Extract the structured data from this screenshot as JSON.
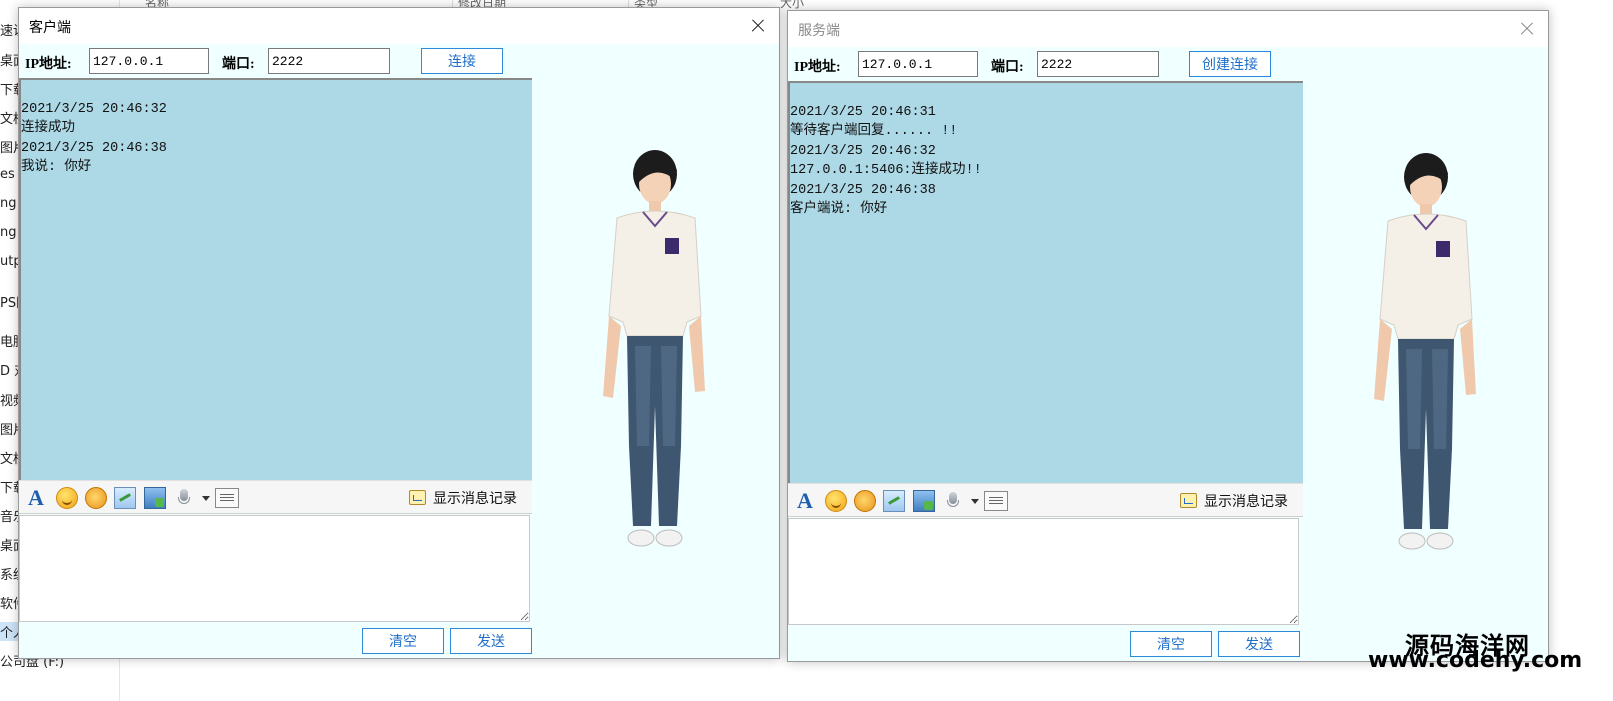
{
  "explorer": {
    "header": {
      "col_name": "名称",
      "col_modified": "修改日期",
      "col_type": "类型",
      "col_size": "大小"
    },
    "nav_items": [
      "速访",
      "桌面",
      "下载",
      "文档",
      "图片",
      "es",
      "ng",
      "ng",
      "utp",
      "PS网",
      "电脑",
      "D 对",
      "视频",
      "图片",
      "文档",
      "下载",
      "音乐",
      "桌面",
      "系统",
      "软件",
      "个人",
      "公司盘 (F:)"
    ]
  },
  "client": {
    "title": "客户端",
    "ip_label": "IP地址:",
    "ip_value": "127.0.0.1",
    "port_label": "端口:",
    "port_value": "2222",
    "connect_label": "连接",
    "log": [
      "",
      "2021/3/25 20:46:32",
      "连接成功",
      "2021/3/25 20:46:38",
      "我说: 你好"
    ],
    "history_label": "显示消息记录",
    "input_value": "",
    "clear_label": "清空",
    "send_label": "发送"
  },
  "server": {
    "title": "服务端",
    "ip_label": "IP地址:",
    "ip_value": "127.0.0.1",
    "port_label": "端口:",
    "port_value": "2222",
    "connect_label": "创建连接",
    "log": [
      "",
      "2021/3/25 20:46:31",
      "等待客户端回复...... !!",
      "2021/3/25 20:46:32",
      "127.0.0.1:5406:连接成功!!",
      "2021/3/25 20:46:38",
      "客户端说: 你好"
    ],
    "history_label": "显示消息记录",
    "input_value": "",
    "clear_label": "清空",
    "send_label": "发送"
  },
  "toolbar_icons": [
    "font-icon",
    "emoji-icon",
    "shake-icon",
    "screenshot-icon",
    "image-icon",
    "voice-icon",
    "dropdown-arrow-icon",
    "file-transfer-icon"
  ],
  "watermark": {
    "line1": "源码海洋网",
    "line2": "www.codehy.com"
  }
}
